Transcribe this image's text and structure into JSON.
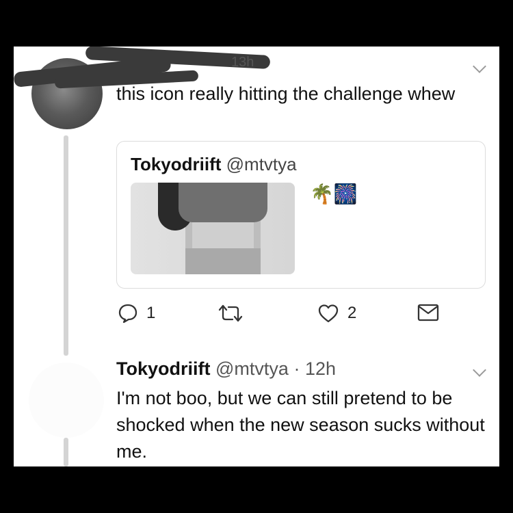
{
  "tweet": {
    "timestamp_partial": "13h",
    "text": "this icon really hitting the challenge whew"
  },
  "quoted": {
    "name": "Tokyodriift",
    "handle": "@mtvtya",
    "emojis": "🌴🎆"
  },
  "actions": {
    "reply_count": "1",
    "like_count": "2"
  },
  "reply": {
    "name": "Tokyodriift",
    "handle": "@mtvtya",
    "separator": "·",
    "time": "12h",
    "text": "I'm not boo, but we can still pretend to be shocked when the new season sucks without me."
  }
}
